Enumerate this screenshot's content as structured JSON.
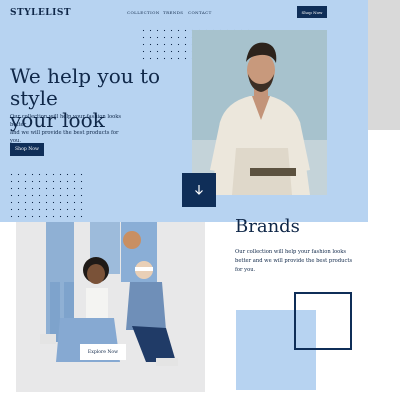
{
  "brand": {
    "logo": "STYLELIST"
  },
  "nav": {
    "items": [
      "COLLECTION",
      "TRENDS",
      "CONTACT"
    ],
    "shop_label": "Shop Now"
  },
  "hero": {
    "title_line1": "We help you to style",
    "title_line2": "your look",
    "subtitle_line1": "Our collection will help your fashion looks better",
    "subtitle_line2": "and we will provide the best products for you.",
    "cta_label": "Shop Now",
    "scroll_icon": "arrow-down-icon"
  },
  "brands": {
    "title": "Brands",
    "text_line1": "Our collection will help your fashion looks",
    "text_line2": "better and we will provide the best products",
    "text_line3": "for you."
  },
  "gallery": {
    "cta_label": "Explore Now"
  },
  "colors": {
    "accent_light": "#b7d3f1",
    "accent_dark": "#0f2e58",
    "text": "#0f2748",
    "background": "#ffffff"
  }
}
